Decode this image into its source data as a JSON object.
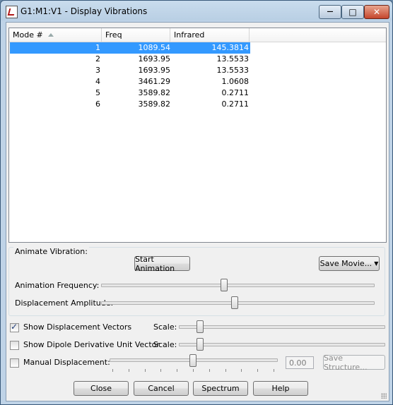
{
  "window": {
    "title": "G1:M1:V1 - Display Vibrations",
    "controls": {
      "minimize": "—",
      "maximize": "□",
      "close": "✕"
    }
  },
  "table": {
    "headers": [
      "Mode #",
      "Freq",
      "Infrared"
    ],
    "rows": [
      {
        "mode": "1",
        "freq": "1089.54",
        "infrared": "145.3814"
      },
      {
        "mode": "2",
        "freq": "1693.95",
        "infrared": "13.5533"
      },
      {
        "mode": "3",
        "freq": "1693.95",
        "infrared": "13.5533"
      },
      {
        "mode": "4",
        "freq": "3461.29",
        "infrared": "1.0608"
      },
      {
        "mode": "5",
        "freq": "3589.82",
        "infrared": "0.2711"
      },
      {
        "mode": "6",
        "freq": "3589.82",
        "infrared": "0.2711"
      }
    ],
    "selected_row": 0
  },
  "animate": {
    "group_label": "Animate Vibration:",
    "start_button": "Start Animation",
    "save_movie_button": "Save Movie...",
    "frequency_label": "Animation Frequency:",
    "frequency_level": 0.45,
    "amplitude_label": "Displacement Amplitude:",
    "amplitude_level": 0.49
  },
  "options": {
    "show_vectors": {
      "label": "Show Displacement Vectors",
      "checked": true,
      "scale_label": "Scale:",
      "scale_level": 0.09
    },
    "show_dipole": {
      "label": "Show Dipole Derivative Unit Vector",
      "checked": false,
      "scale_label": "Scale:",
      "scale_level": 0.09
    },
    "manual": {
      "label": "Manual Displacement:",
      "checked": false,
      "value": "0.00",
      "level": 0.5,
      "save_button": "Save Structure..."
    }
  },
  "buttons": {
    "close": "Close",
    "cancel": "Cancel",
    "spectrum": "Spectrum",
    "help": "Help"
  }
}
